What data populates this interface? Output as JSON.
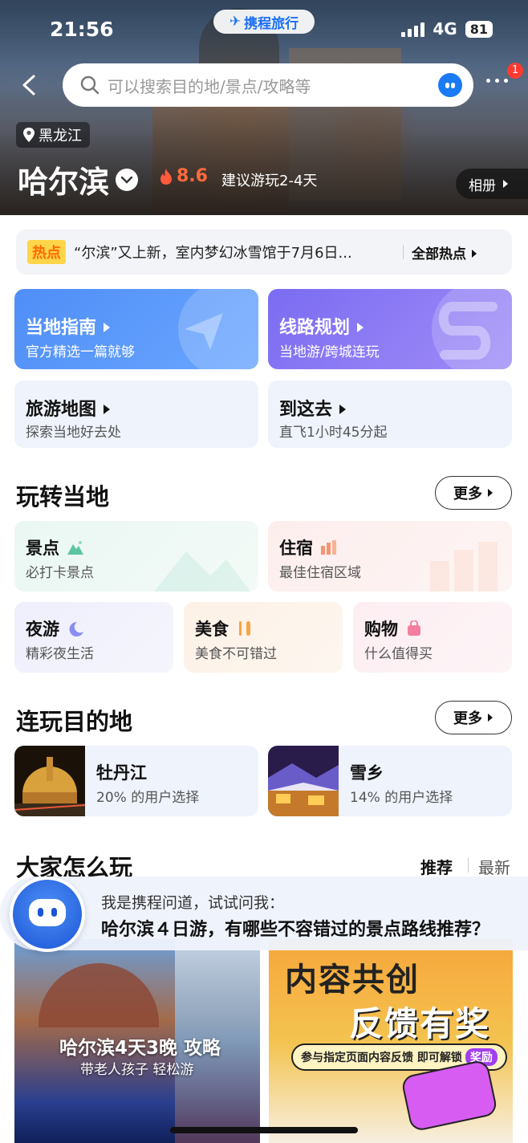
{
  "status_bar": {
    "time": "21:56",
    "app_badge": "携程旅行",
    "network": "4G",
    "battery": "81"
  },
  "header": {
    "search_placeholder": "可以搜索目的地/景点/攻略等",
    "notification_count": "1"
  },
  "hero": {
    "province": "黑龙江",
    "city": "哈尔滨",
    "score": "8.6",
    "suggested_duration": "建议游玩2-4天",
    "album_label": "相册"
  },
  "hot": {
    "tag": "热点",
    "text": "“尔滨”又上新，室内梦幻冰雪馆于7月6日...",
    "all_label": "全部热点"
  },
  "guide_cards": [
    {
      "title": "当地指南",
      "subtitle": "官方精选一篇就够"
    },
    {
      "title": "线路规划",
      "subtitle": "当地游/跨城连玩"
    },
    {
      "title": "旅游地图",
      "subtitle": "探索当地好去处"
    },
    {
      "title": "到这去",
      "subtitle": "直飞1小时45分起"
    }
  ],
  "play_local": {
    "title": "玩转当地",
    "more_label": "更多",
    "items": [
      {
        "title": "景点",
        "subtitle": "必打卡景点",
        "icon": "mountain-icon"
      },
      {
        "title": "住宿",
        "subtitle": "最佳住宿区域",
        "icon": "hotel-icon"
      },
      {
        "title": "夜游",
        "subtitle": "精彩夜生活",
        "icon": "moon-icon"
      },
      {
        "title": "美食",
        "subtitle": "美食不可错过",
        "icon": "cutlery-icon"
      },
      {
        "title": "购物",
        "subtitle": "什么值得买",
        "icon": "shopping-bag-icon"
      }
    ]
  },
  "linked_destinations": {
    "title": "连玩目的地",
    "more_label": "更多",
    "items": [
      {
        "name": "牡丹江",
        "share": "20% 的用户选择"
      },
      {
        "name": "雪乡",
        "share": "14% 的用户选择"
      }
    ]
  },
  "how_to_play": {
    "title": "大家怎么玩",
    "tab_recommend": "推荐",
    "tab_latest": "最新"
  },
  "ai_assistant": {
    "intro": "我是携程问道，试试问我：",
    "question": "哈尔滨４日游，有哪些不容错过的景点路线推荐？"
  },
  "feed": {
    "left": {
      "title": "哈尔滨4天3晚 攻略",
      "subtitle": "带老人孩子 轻松游"
    },
    "right": {
      "line1": "内容共创",
      "line2": "反馈有奖",
      "banner": "参与指定页面内容反馈 即可解锁",
      "reward": "奖励"
    }
  },
  "colors": {
    "brand_blue": "#1b6ff5",
    "hot_orange": "#ff6a00",
    "score_orange": "#ff6a3d"
  }
}
